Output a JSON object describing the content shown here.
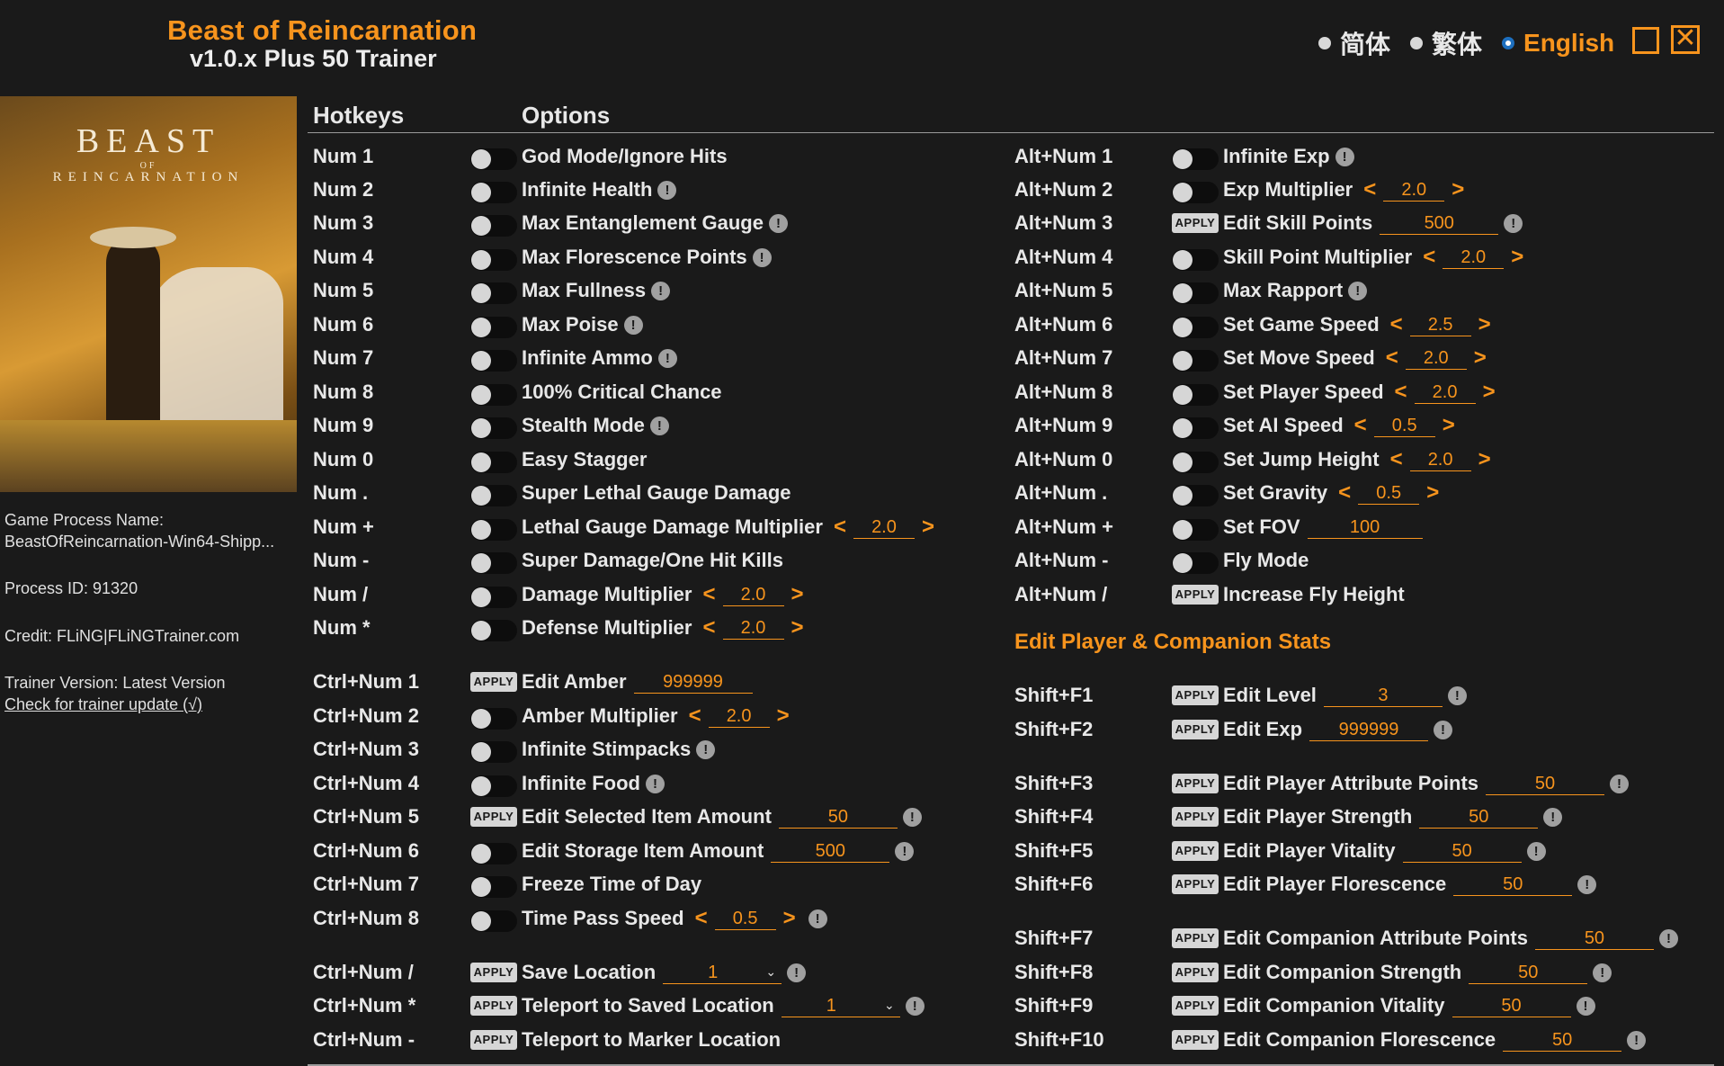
{
  "app": {
    "title": "Beast of Reincarnation",
    "subtitle": "v1.0.x Plus 50 Trainer"
  },
  "languages": [
    {
      "label": "简体",
      "selected": false
    },
    {
      "label": "繁体",
      "selected": false
    },
    {
      "label": "English",
      "selected": true
    }
  ],
  "cover": {
    "title": "BEAST",
    "of": "OF",
    "subtitle": "REINCARNATION"
  },
  "sidebar": {
    "process_name_label": "Game Process Name:",
    "process_name": "BeastOfReincarnation-Win64-Shipp...",
    "process_id": "Process ID: 91320",
    "credit": "Credit: FLiNG|FLiNGTrainer.com",
    "trainer_version": "Trainer Version: Latest Version",
    "update_link": "Check for trainer update (√)"
  },
  "headers": {
    "hotkeys": "Hotkeys",
    "options": "Options"
  },
  "section_title": "Edit Player & Companion Stats",
  "apply_label": "APPLY",
  "info_glyph": "!",
  "arrow_left": "<",
  "arrow_right": ">",
  "left_column": [
    {
      "hotkey": "Num 1",
      "control": "toggle",
      "label": "God Mode/Ignore Hits",
      "info": false
    },
    {
      "hotkey": "Num 2",
      "control": "toggle",
      "label": "Infinite Health",
      "info": true
    },
    {
      "hotkey": "Num 3",
      "control": "toggle",
      "label": "Max Entanglement Gauge",
      "info": true
    },
    {
      "hotkey": "Num 4",
      "control": "toggle",
      "label": "Max Florescence Points",
      "info": true
    },
    {
      "hotkey": "Num 5",
      "control": "toggle",
      "label": "Max Fullness",
      "info": true
    },
    {
      "hotkey": "Num 6",
      "control": "toggle",
      "label": "Max Poise",
      "info": true
    },
    {
      "hotkey": "Num 7",
      "control": "toggle",
      "label": "Infinite Ammo",
      "info": true
    },
    {
      "hotkey": "Num 8",
      "control": "toggle",
      "label": "100% Critical Chance",
      "info": false
    },
    {
      "hotkey": "Num 9",
      "control": "toggle",
      "label": "Stealth Mode",
      "info": true
    },
    {
      "hotkey": "Num 0",
      "control": "toggle",
      "label": "Easy Stagger",
      "info": false
    },
    {
      "hotkey": "Num .",
      "control": "toggle",
      "label": "Super Lethal Gauge Damage",
      "info": false
    },
    {
      "hotkey": "Num +",
      "control": "toggle",
      "label": "Lethal Gauge Damage Multiplier",
      "stepper": "2.0",
      "info": false
    },
    {
      "hotkey": "Num -",
      "control": "toggle",
      "label": "Super Damage/One Hit Kills",
      "info": false
    },
    {
      "hotkey": "Num /",
      "control": "toggle",
      "label": "Damage Multiplier",
      "stepper": "2.0",
      "info": false
    },
    {
      "hotkey": "Num *",
      "control": "toggle",
      "label": "Defense Multiplier",
      "stepper": "2.0",
      "info": false
    },
    {
      "hotkey": "Ctrl+Num 1",
      "control": "apply",
      "label": "Edit Amber",
      "value": "999999",
      "info": false
    },
    {
      "hotkey": "Ctrl+Num 2",
      "control": "toggle",
      "label": "Amber Multiplier",
      "stepper": "2.0",
      "info": false
    },
    {
      "hotkey": "Ctrl+Num 3",
      "control": "toggle",
      "label": "Infinite Stimpacks",
      "info": true
    },
    {
      "hotkey": "Ctrl+Num 4",
      "control": "toggle",
      "label": "Infinite Food",
      "info": true
    },
    {
      "hotkey": "Ctrl+Num 5",
      "control": "apply",
      "label": "Edit Selected Item Amount",
      "value": "50",
      "info": true
    },
    {
      "hotkey": "Ctrl+Num 6",
      "control": "toggle",
      "label": "Edit Storage Item Amount",
      "value": "500",
      "info": true
    },
    {
      "hotkey": "Ctrl+Num 7",
      "control": "toggle",
      "label": "Freeze Time of Day",
      "info": false
    },
    {
      "hotkey": "Ctrl+Num 8",
      "control": "toggle",
      "label": "Time Pass Speed",
      "stepper": "0.5",
      "info": true
    },
    {
      "hotkey": "Ctrl+Num /",
      "control": "apply",
      "label": "Save Location",
      "dropdown": "1",
      "info": true
    },
    {
      "hotkey": "Ctrl+Num *",
      "control": "apply",
      "label": "Teleport to Saved Location",
      "dropdown": "1",
      "info": true
    },
    {
      "hotkey": "Ctrl+Num -",
      "control": "apply",
      "label": "Teleport to Marker Location",
      "info": false
    }
  ],
  "right_column": [
    {
      "hotkey": "Alt+Num 1",
      "control": "toggle",
      "label": "Infinite Exp",
      "info": true
    },
    {
      "hotkey": "Alt+Num 2",
      "control": "toggle",
      "label": "Exp Multiplier",
      "stepper": "2.0",
      "info": false
    },
    {
      "hotkey": "Alt+Num 3",
      "control": "apply",
      "label": "Edit Skill Points",
      "value": "500",
      "info": true
    },
    {
      "hotkey": "Alt+Num 4",
      "control": "toggle",
      "label": "Skill Point Multiplier",
      "stepper": "2.0",
      "info": false
    },
    {
      "hotkey": "Alt+Num 5",
      "control": "toggle",
      "label": "Max Rapport",
      "info": true
    },
    {
      "hotkey": "Alt+Num 6",
      "control": "toggle",
      "label": "Set Game Speed",
      "stepper": "2.5",
      "info": false
    },
    {
      "hotkey": "Alt+Num 7",
      "control": "toggle",
      "label": "Set Move Speed",
      "stepper": "2.0",
      "info": false
    },
    {
      "hotkey": "Alt+Num 8",
      "control": "toggle",
      "label": "Set Player Speed",
      "stepper": "2.0",
      "info": false
    },
    {
      "hotkey": "Alt+Num 9",
      "control": "toggle",
      "label": "Set AI Speed",
      "stepper": "0.5",
      "info": false
    },
    {
      "hotkey": "Alt+Num 0",
      "control": "toggle",
      "label": "Set Jump Height",
      "stepper": "2.0",
      "info": false
    },
    {
      "hotkey": "Alt+Num .",
      "control": "toggle",
      "label": "Set Gravity",
      "stepper": "0.5",
      "info": false
    },
    {
      "hotkey": "Alt+Num +",
      "control": "toggle",
      "label": "Set FOV",
      "value": "100",
      "info": false
    },
    {
      "hotkey": "Alt+Num -",
      "control": "toggle",
      "label": "Fly Mode",
      "info": false
    },
    {
      "hotkey": "Alt+Num /",
      "control": "apply",
      "label": "Increase Fly Height",
      "info": false
    },
    {
      "hotkey": "Shift+F1",
      "control": "apply",
      "label": "Edit Level",
      "value": "3",
      "info": true
    },
    {
      "hotkey": "Shift+F2",
      "control": "apply",
      "label": "Edit Exp",
      "value": "999999",
      "info": true
    },
    {
      "hotkey": "Shift+F3",
      "control": "apply",
      "label": "Edit Player Attribute Points",
      "value": "50",
      "info": true
    },
    {
      "hotkey": "Shift+F4",
      "control": "apply",
      "label": "Edit Player Strength",
      "value": "50",
      "info": true
    },
    {
      "hotkey": "Shift+F5",
      "control": "apply",
      "label": "Edit Player Vitality",
      "value": "50",
      "info": true
    },
    {
      "hotkey": "Shift+F6",
      "control": "apply",
      "label": "Edit Player Florescence",
      "value": "50",
      "info": true
    },
    {
      "hotkey": "Shift+F7",
      "control": "apply",
      "label": "Edit Companion Attribute Points",
      "value": "50",
      "info": true
    },
    {
      "hotkey": "Shift+F8",
      "control": "apply",
      "label": "Edit Companion Strength",
      "value": "50",
      "info": true
    },
    {
      "hotkey": "Shift+F9",
      "control": "apply",
      "label": "Edit Companion Vitality",
      "value": "50",
      "info": true
    },
    {
      "hotkey": "Shift+F10",
      "control": "apply",
      "label": "Edit Companion Florescence",
      "value": "50",
      "info": true
    }
  ]
}
